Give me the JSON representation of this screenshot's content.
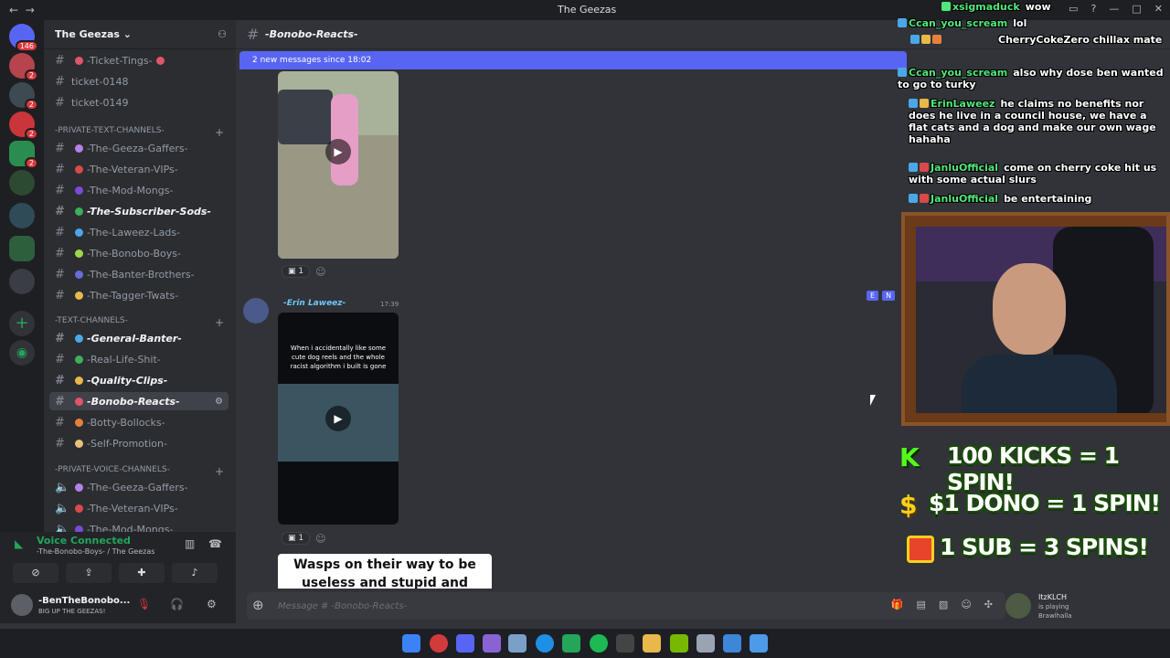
{
  "window": {
    "title": "The Geezas",
    "back": "←",
    "forward": "→"
  },
  "server": {
    "name": "The Geezas",
    "rail_badges": [
      "146",
      "2",
      "2",
      "2",
      "2"
    ]
  },
  "sidebar": {
    "top_channels": [
      "-Ticket-Tings-",
      "ticket-0148",
      "ticket-0149"
    ],
    "categories": {
      "private_text": "-PRIVATE-TEXT-CHANNELS-",
      "text": "-TEXT-CHANNELS-",
      "private_voice": "-PRIVATE-VOICE-CHANNELS-"
    },
    "private_text_channels": [
      "-The-Geeza-Gaffers-",
      "-The-Veteran-VIPs-",
      "-The-Mod-Mongs-",
      "-The-Subscriber-Sods-",
      "-The-Laweez-Lads-",
      "-The-Bonobo-Boys-",
      "-The-Banter-Brothers-",
      "-The-Tagger-Twats-"
    ],
    "text_channels": [
      "-General-Banter-",
      "-Real-Life-Shit-",
      "-Quality-Clips-",
      "-Bonobo-Reacts-",
      "-Botty-Bollocks-",
      "-Self-Promotion-"
    ],
    "voice_channels": [
      "-The-Geeza-Gaffers-",
      "-The-Veteran-VIPs-",
      "-The-Mod-Mongs-"
    ]
  },
  "voice": {
    "status": "Voice Connected",
    "location": "-The-Bonobo-Boys- / The Geezas"
  },
  "user": {
    "name": "-BenTheBonobo...",
    "status": "BIG UP THE GEEZAS!"
  },
  "chat": {
    "channel": "-Bonobo-Reacts-",
    "new_messages": "2 new messages since 18:02",
    "reaction_count_1": "1",
    "reaction_count_2": "1",
    "author": "-Erin Laweez-",
    "timestamp": "17:39",
    "video_caption": "When i accidentally like some cute dog reels and the whole racist algorithm i built is gone",
    "meme_text": "Wasps on their way to be useless and stupid and",
    "input_placeholder": "Message # -Bonobo-Reacts-",
    "hover_tags": [
      "E",
      "N"
    ]
  },
  "stream_chat": [
    {
      "name": "xsigmaduck",
      "text": "wow"
    },
    {
      "name": "Ccan_you_scream",
      "text": "lol"
    },
    {
      "name": "",
      "text": "CherryCokeZero chillax mate"
    },
    {
      "name": "Ccan_you_scream",
      "text": "also why dose ben wanted to go to turky"
    },
    {
      "name": "ErinLaweez",
      "text": "he claims no benefits nor does he live in a council house, we have a flat cats and a dog and make our own wage hahaha"
    },
    {
      "name": "JanluOfficial",
      "text": "come on cherry coke hit us with some actual slurs"
    },
    {
      "name": "JanluOfficial",
      "text": "be entertaining"
    }
  ],
  "promo": {
    "line1_prefix": "K",
    "line1": "100 KICKS = 1 SPIN!",
    "line2_prefix": "$",
    "line2": "$1 DONO = 1 SPIN!",
    "line3": "1 SUB = 3 SPINS!"
  },
  "member": {
    "name": "ItzKLCH",
    "status": "is playing",
    "game": "Brawlhalla"
  },
  "colors": {
    "blurple": "#5865f2",
    "green_name": "#51e87a",
    "bg": "#313338",
    "sidebar": "#2b2d31"
  }
}
